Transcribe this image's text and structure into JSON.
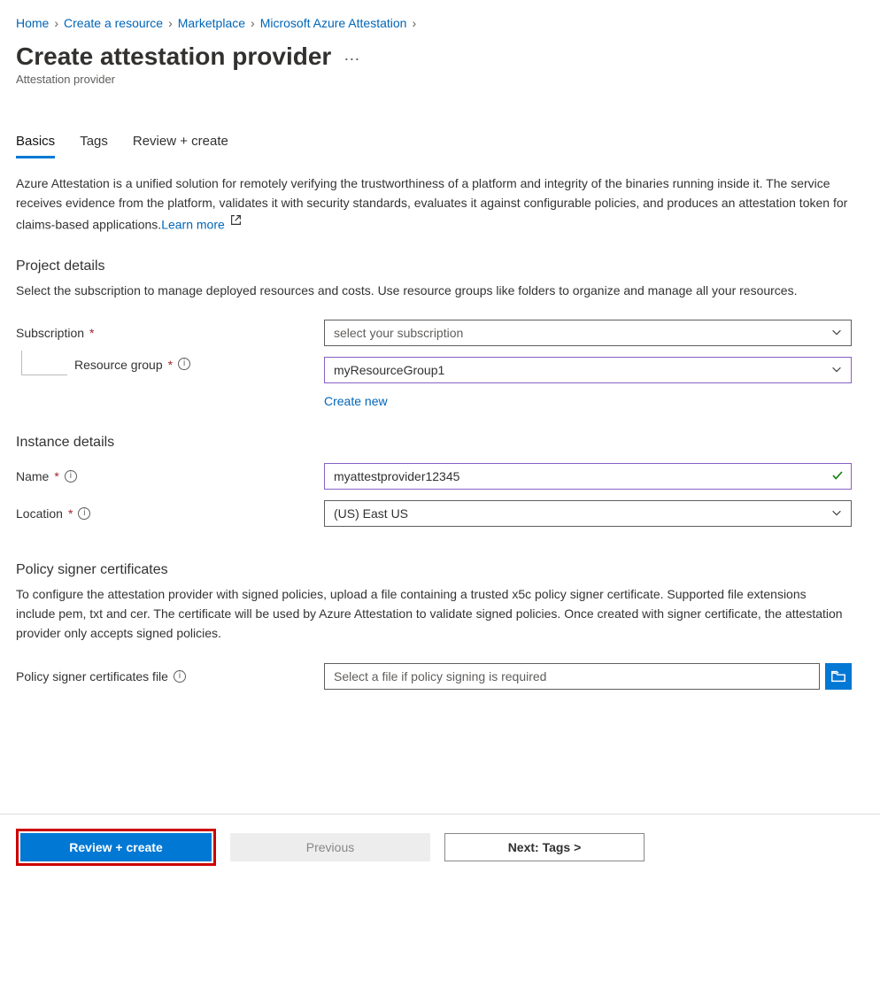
{
  "breadcrumb": {
    "items": [
      "Home",
      "Create a resource",
      "Marketplace",
      "Microsoft Azure Attestation"
    ]
  },
  "page": {
    "title": "Create attestation provider",
    "subtitle": "Attestation provider"
  },
  "tabs": {
    "items": [
      "Basics",
      "Tags",
      "Review + create"
    ],
    "active": 0
  },
  "intro": {
    "text": "Azure Attestation is a unified solution for remotely verifying the trustworthiness of a platform and integrity of the binaries running inside it. The service receives evidence from the platform, validates it with security standards, evaluates it against configurable policies, and produces an attestation token for claims-based applications.",
    "learn_more": "Learn more"
  },
  "project": {
    "title": "Project details",
    "desc": "Select the subscription to manage deployed resources and costs. Use resource groups like folders to organize and manage all your resources.",
    "subscription_label": "Subscription",
    "subscription_value": "select your subscription",
    "rg_label": "Resource group",
    "rg_value": "myResourceGroup1",
    "create_new": "Create new"
  },
  "instance": {
    "title": "Instance details",
    "name_label": "Name",
    "name_value": "myattestprovider12345",
    "location_label": "Location",
    "location_value": "(US) East US"
  },
  "policy": {
    "title": "Policy signer certificates",
    "desc": "To configure the attestation provider with signed policies, upload a file containing a trusted x5c policy signer certificate. Supported file extensions include pem, txt and cer. The certificate will be used by Azure Attestation to validate signed policies. Once created with signer certificate, the attestation provider only accepts signed policies.",
    "file_label": "Policy signer certificates file",
    "file_placeholder": "Select a file if policy signing is required"
  },
  "footer": {
    "review": "Review + create",
    "previous": "Previous",
    "next": "Next: Tags >"
  }
}
